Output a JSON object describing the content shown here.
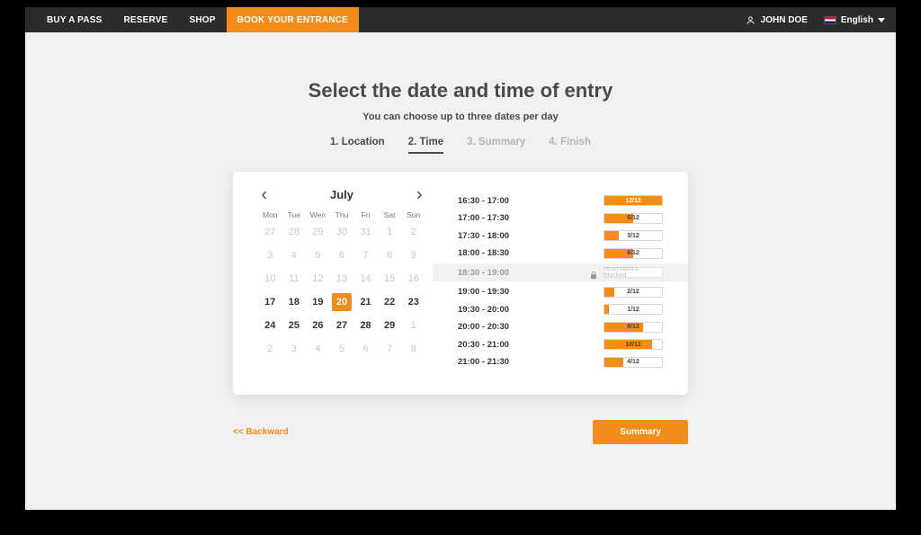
{
  "nav": {
    "items": [
      {
        "label": "BUY A PASS",
        "active": false
      },
      {
        "label": "RESERVE",
        "active": false
      },
      {
        "label": "SHOP",
        "active": false
      },
      {
        "label": "BOOK YOUR ENTRANCE",
        "active": true
      }
    ],
    "user": "JOHN DOE",
    "language": "English"
  },
  "page": {
    "title": "Select the date and time of entry",
    "subtitle": "You can choose up to three dates per day",
    "steps": [
      {
        "label": "1. Location",
        "state": "completed"
      },
      {
        "label": "2. Time",
        "state": "active"
      },
      {
        "label": "3. Summary",
        "state": "upcoming"
      },
      {
        "label": "4. Finish",
        "state": "upcoming"
      }
    ]
  },
  "calendar": {
    "month": "July",
    "dow": [
      "Mon",
      "Tue",
      "Wen",
      "Thu",
      "Fri",
      "Sat",
      "Sun"
    ],
    "weeks": [
      [
        {
          "n": 27,
          "dim": true
        },
        {
          "n": 28,
          "dim": true
        },
        {
          "n": 29,
          "dim": true
        },
        {
          "n": 30,
          "dim": true
        },
        {
          "n": 31,
          "dim": true
        },
        {
          "n": 1,
          "dim": true
        },
        {
          "n": 2,
          "dim": true
        }
      ],
      [
        {
          "n": 3,
          "dim": true
        },
        {
          "n": 4,
          "dim": true
        },
        {
          "n": 5,
          "dim": true
        },
        {
          "n": 6,
          "dim": true
        },
        {
          "n": 7,
          "dim": true
        },
        {
          "n": 8,
          "dim": true
        },
        {
          "n": 9,
          "dim": true
        }
      ],
      [
        {
          "n": 10,
          "dim": true
        },
        {
          "n": 11,
          "dim": true
        },
        {
          "n": 12,
          "dim": true
        },
        {
          "n": 13,
          "dim": true
        },
        {
          "n": 14,
          "dim": true
        },
        {
          "n": 15,
          "dim": true
        },
        {
          "n": 16,
          "dim": true
        }
      ],
      [
        {
          "n": 17,
          "dim": false
        },
        {
          "n": 18,
          "dim": false
        },
        {
          "n": 19,
          "dim": false
        },
        {
          "n": 20,
          "dim": false,
          "sel": true
        },
        {
          "n": 21,
          "dim": false
        },
        {
          "n": 22,
          "dim": false
        },
        {
          "n": 23,
          "dim": false
        }
      ],
      [
        {
          "n": 24,
          "dim": false
        },
        {
          "n": 25,
          "dim": false
        },
        {
          "n": 26,
          "dim": false
        },
        {
          "n": 27,
          "dim": false
        },
        {
          "n": 28,
          "dim": false
        },
        {
          "n": 29,
          "dim": false
        },
        {
          "n": 1,
          "dim": true
        }
      ],
      [
        {
          "n": 2,
          "dim": true
        },
        {
          "n": 3,
          "dim": true
        },
        {
          "n": 4,
          "dim": true
        },
        {
          "n": 5,
          "dim": true
        },
        {
          "n": 6,
          "dim": true
        },
        {
          "n": 7,
          "dim": true
        },
        {
          "n": 8,
          "dim": true
        }
      ]
    ]
  },
  "slots": [
    {
      "label": "16:30 - 17:00",
      "booked": 12,
      "capacity": 12
    },
    {
      "label": "17:00 - 17:30",
      "booked": 6,
      "capacity": 12
    },
    {
      "label": "17:30 - 18:00",
      "booked": 3,
      "capacity": 12
    },
    {
      "label": "18:00 - 18:30",
      "booked": 6,
      "capacity": 12
    },
    {
      "label": "18:30 - 19:00",
      "blocked": true,
      "blocked_text": "reservations blocked"
    },
    {
      "label": "19:00 - 19:30",
      "booked": 2,
      "capacity": 12
    },
    {
      "label": "19:30 - 20:00",
      "booked": 1,
      "capacity": 12
    },
    {
      "label": "20:00 - 20:30",
      "booked": 8,
      "capacity": 12
    },
    {
      "label": "20:30 - 21:00",
      "booked": 10,
      "capacity": 12
    },
    {
      "label": "21:00 - 21:30",
      "booked": 4,
      "capacity": 12
    }
  ],
  "footer": {
    "back": "<< Backward",
    "summary": "Summary"
  },
  "colors": {
    "accent": "#f28c1a"
  }
}
